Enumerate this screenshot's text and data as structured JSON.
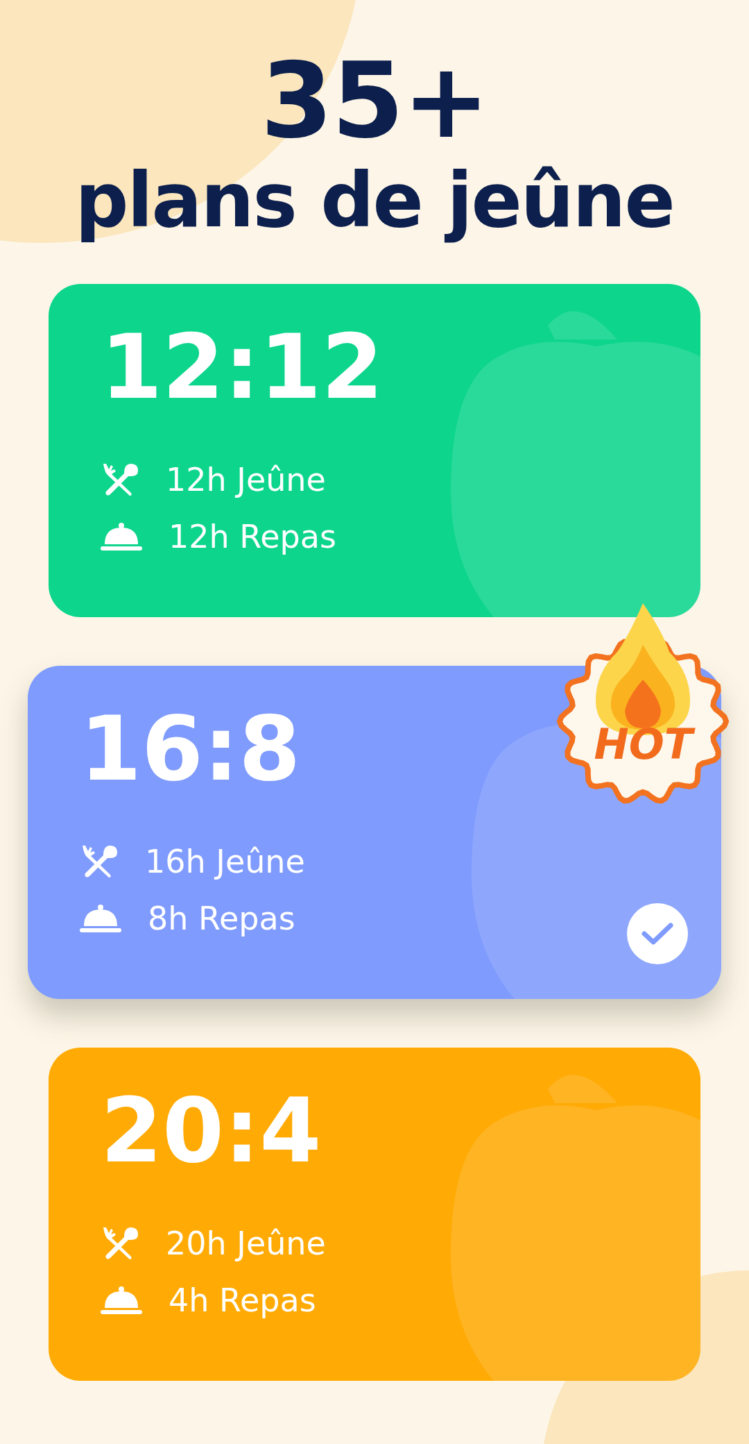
{
  "headline": {
    "count": "35+",
    "subtitle": "plans de jeûne"
  },
  "plans": [
    {
      "ratio": "12:12",
      "fasting": "12h Jeûne",
      "eating": "12h Repas",
      "color": "#0dd58c",
      "selected": false,
      "hot": false
    },
    {
      "ratio": "16:8",
      "fasting": "16h Jeûne",
      "eating": "8h Repas",
      "color": "#7f9bfd",
      "selected": true,
      "hot": true,
      "badge": "HOT"
    },
    {
      "ratio": "20:4",
      "fasting": "20h Jeûne",
      "eating": "4h Repas",
      "color": "#ffaa05",
      "selected": false,
      "hot": false
    }
  ]
}
